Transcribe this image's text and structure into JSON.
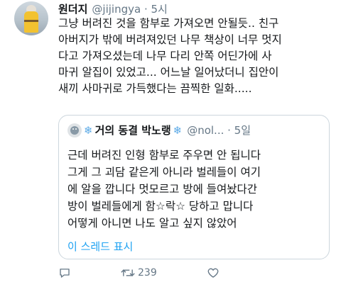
{
  "author": {
    "name": "원더지",
    "handle_time": "@jijingya · 5시"
  },
  "tweet": {
    "text": "그냥 버려진 것을 함부로 가져오면 안될듯.. 친구\n아버지가 밖에 버려져있던 나무 책상이 너무 멋지\n다고 가져오셨는데 나무  다리 안쪽 어딘가에 사\n마귀 알집이 있었고... 어느날 일어났더니 집안이\n새끼 사마귀로 가득했다는 끔찍한 일화....."
  },
  "quoted": {
    "snowflake": "❄",
    "name": "거의 동결 박노랭",
    "handle_time": "@nol... · 5일",
    "text": "근데 버려진 인형 함부로 주우면 안 됩니다\n그게 그 괴담 같은게 아니라 벌레들이 여기\n에 알을 깝니다 멋모르고 방에 들여놨다간\n방이 벌레들에게 함☆락☆ 당하고 맙니다\n어떻게 아니면 나도 알고 싶지 않았어",
    "show_thread": "이 스레드 표시"
  },
  "actions": {
    "reply_icon": "reply-icon",
    "retweet_icon": "retweet-icon",
    "retweet_count": "239",
    "like_icon": "heart-icon"
  },
  "colors": {
    "accent": "#1da1f2",
    "muted": "#657786",
    "border": "#ccd6dd"
  }
}
